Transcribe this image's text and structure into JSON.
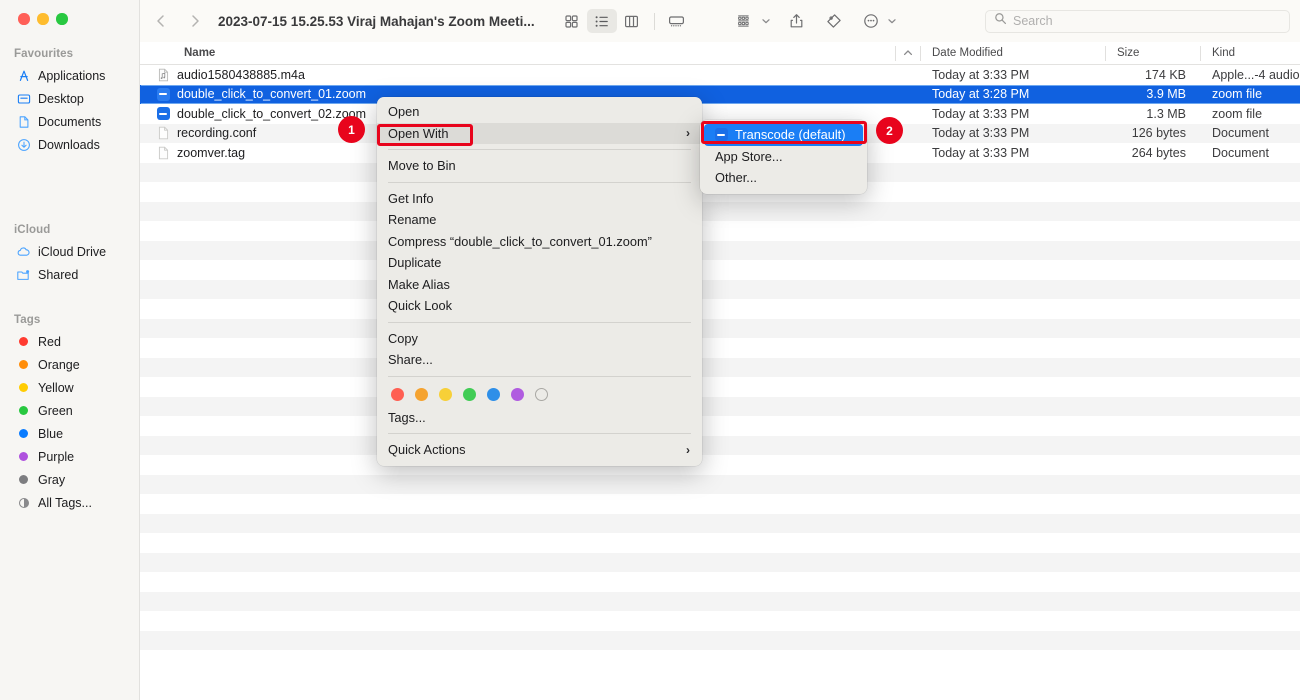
{
  "window": {
    "title": "2023-07-15 15.25.53 Viraj Mahajan's Zoom Meeti...",
    "traffic_lights": [
      {
        "name": "close",
        "color": "#ff5f57"
      },
      {
        "name": "minimize",
        "color": "#febc2e"
      },
      {
        "name": "zoom",
        "color": "#28c840"
      }
    ]
  },
  "toolbar": {
    "back_label": "‹",
    "forward_label": "›",
    "view_icon_grid": "grid-view-icon",
    "view_icon_list": "list-view-icon",
    "view_icon_column": "column-view-icon",
    "view_icon_gallery": "gallery-view-icon",
    "group_icon": "group-by-icon",
    "share_icon": "share-icon",
    "tag_icon": "tag-icon",
    "more_icon": "more-options-icon",
    "chevron": "⌄"
  },
  "search": {
    "placeholder": "Search",
    "value": "",
    "icon": "search-icon"
  },
  "sidebar": {
    "sections": [
      {
        "title": "Favourites",
        "items": [
          {
            "label": "Applications",
            "icon": "applications-icon"
          },
          {
            "label": "Desktop",
            "icon": "desktop-icon"
          },
          {
            "label": "Documents",
            "icon": "documents-icon"
          },
          {
            "label": "Downloads",
            "icon": "downloads-icon"
          }
        ]
      },
      {
        "title": "iCloud",
        "items": [
          {
            "label": "iCloud Drive",
            "icon": "icloud-drive-icon"
          },
          {
            "label": "Shared",
            "icon": "shared-folder-icon"
          }
        ]
      },
      {
        "title": "Tags",
        "items": [
          {
            "label": "Red",
            "icon": "tag-dot-icon",
            "color": "#ff3b30"
          },
          {
            "label": "Orange",
            "icon": "tag-dot-icon",
            "color": "#ff8d0a"
          },
          {
            "label": "Yellow",
            "icon": "tag-dot-icon",
            "color": "#ffcc02"
          },
          {
            "label": "Green",
            "icon": "tag-dot-icon",
            "color": "#28c840"
          },
          {
            "label": "Blue",
            "icon": "tag-dot-icon",
            "color": "#0a7cff"
          },
          {
            "label": "Purple",
            "icon": "tag-dot-icon",
            "color": "#af52de"
          },
          {
            "label": "Gray",
            "icon": "tag-dot-icon",
            "color": "#7d7d80"
          },
          {
            "label": "All Tags...",
            "icon": "all-tags-icon",
            "color": ""
          }
        ]
      }
    ]
  },
  "file_list": {
    "columns": [
      "Name",
      "Date Modified",
      "Size",
      "Kind"
    ],
    "sort_indicator": "⌃",
    "rows": [
      {
        "name": "audio1580438885.m4a",
        "date": "Today at 3:33 PM",
        "size": "174 KB",
        "kind": "Apple...-4 audio",
        "icon": "audio-file-icon",
        "selected": false
      },
      {
        "name": "double_click_to_convert_01.zoom",
        "date": "Today at 3:28 PM",
        "size": "3.9 MB",
        "kind": "zoom file",
        "icon": "zoom-file-icon",
        "selected": true
      },
      {
        "name": "double_click_to_convert_02.zoom",
        "date": "Today at 3:33 PM",
        "size": "1.3 MB",
        "kind": "zoom file",
        "icon": "zoom-file-icon",
        "selected": false
      },
      {
        "name": "recording.conf",
        "date": "Today at 3:33 PM",
        "size": "126 bytes",
        "kind": "Document",
        "icon": "document-file-icon",
        "selected": false
      },
      {
        "name": "zoomver.tag",
        "date": "Today at 3:33 PM",
        "size": "264 bytes",
        "kind": "Document",
        "icon": "document-file-icon",
        "selected": false
      }
    ]
  },
  "context_menu": {
    "items": [
      {
        "label": "Open",
        "highlighted": false,
        "submenu": false
      },
      {
        "label": "Open With",
        "highlighted": true,
        "submenu": true
      },
      {
        "label": "Move to Bin",
        "highlighted": false,
        "submenu": false
      },
      {
        "label": "Get Info",
        "highlighted": false,
        "submenu": false
      },
      {
        "label": "Rename",
        "highlighted": false,
        "submenu": false
      },
      {
        "label": "Compress “double_click_to_convert_01.zoom”",
        "highlighted": false,
        "submenu": false
      },
      {
        "label": "Duplicate",
        "highlighted": false,
        "submenu": false
      },
      {
        "label": "Make Alias",
        "highlighted": false,
        "submenu": false
      },
      {
        "label": "Quick Look",
        "highlighted": false,
        "submenu": false
      },
      {
        "label": "Copy",
        "highlighted": false,
        "submenu": false
      },
      {
        "label": "Share...",
        "highlighted": false,
        "submenu": false
      },
      {
        "label": "Tags...",
        "highlighted": false,
        "submenu": false
      },
      {
        "label": "Quick Actions",
        "highlighted": false,
        "submenu": true
      }
    ],
    "tag_colors": [
      "#ff5f52",
      "#f5a330",
      "#f7d038",
      "#41cc55",
      "#2e8fe8",
      "#b05ce0",
      ""
    ],
    "submenu_arrow": "›"
  },
  "submenu": {
    "items": [
      {
        "label": "Transcode (default)",
        "selected": true,
        "icon": "zoom-app-icon"
      },
      {
        "label": "App Store...",
        "selected": false,
        "icon": ""
      },
      {
        "label": "Other...",
        "selected": false,
        "icon": ""
      }
    ]
  },
  "annotations": [
    {
      "badge": "1",
      "target": "open-with-menu-item"
    },
    {
      "badge": "2",
      "target": "transcode-submenu-item"
    }
  ]
}
